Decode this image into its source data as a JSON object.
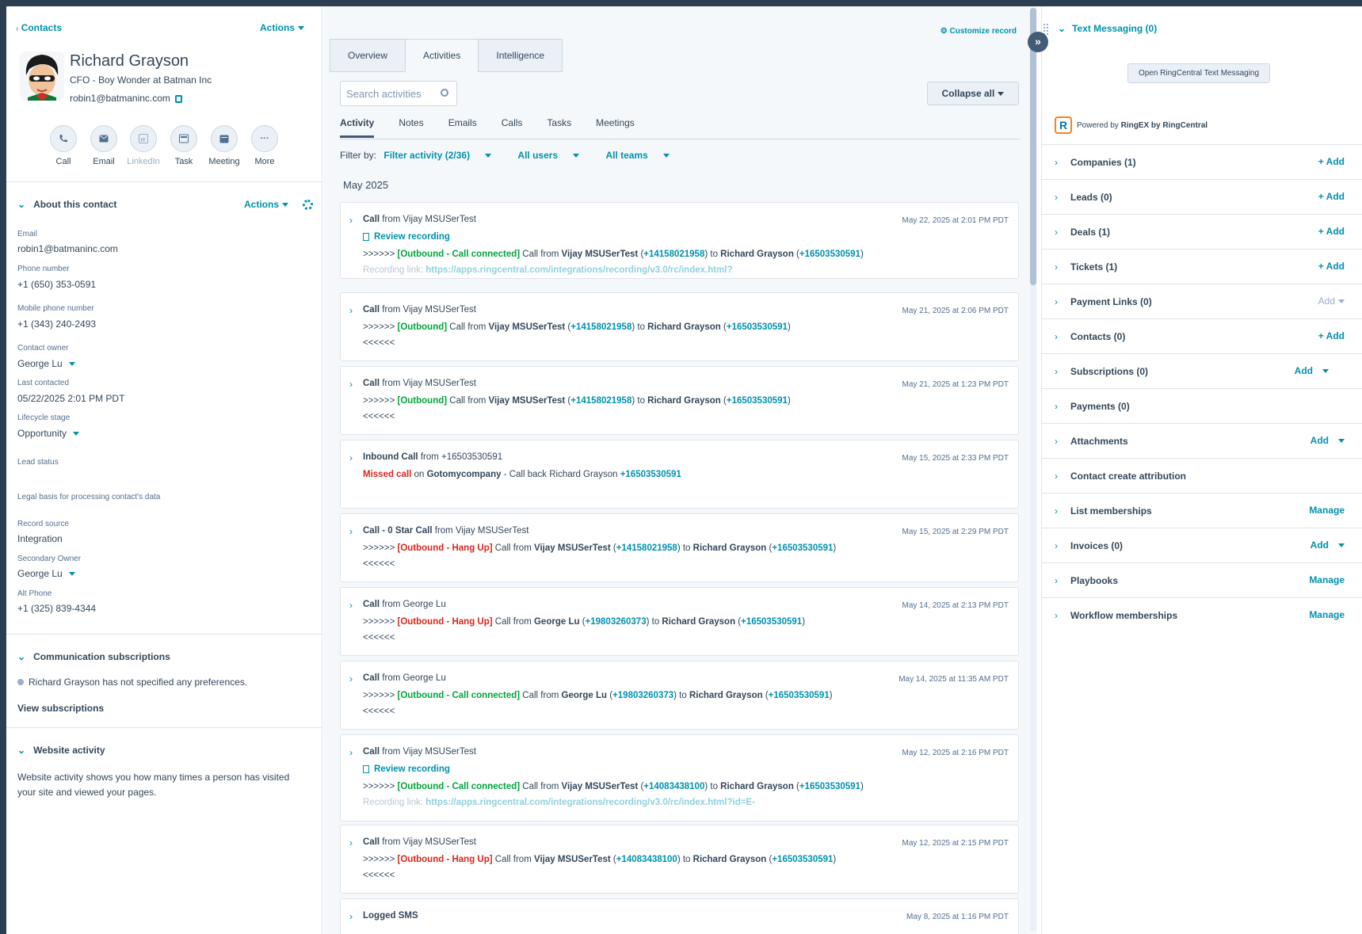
{
  "header": {
    "breadcrumb": "Contacts",
    "actions_label": "Actions"
  },
  "contact": {
    "name": "Richard Grayson",
    "subtitle": "CFO - Boy Wonder at Batman Inc",
    "email": "robin1@batmaninc.com"
  },
  "quick_actions": [
    {
      "label": "Call",
      "icon": "phone-icon"
    },
    {
      "label": "Email",
      "icon": "email-icon"
    },
    {
      "label": "LinkedIn",
      "icon": "linkedin-icon"
    },
    {
      "label": "Task",
      "icon": "task-icon"
    },
    {
      "label": "Meeting",
      "icon": "meeting-icon"
    },
    {
      "label": "More",
      "icon": "more-icon"
    }
  ],
  "about": {
    "title": "About this contact",
    "actions_label": "Actions",
    "fields": [
      {
        "label": "Email",
        "value": "robin1@batmaninc.com"
      },
      {
        "label": "Phone number",
        "value": "+1 (650) 353-0591"
      },
      {
        "label": "Mobile phone number",
        "value": "+1 (343) 240-2493"
      },
      {
        "label": "Contact owner",
        "value": "George Lu"
      },
      {
        "label": "Last contacted",
        "value": "05/22/2025 2:01 PM PDT"
      },
      {
        "label": "Lifecycle stage",
        "value": "Opportunity"
      },
      {
        "label": "Lead status",
        "value": ""
      },
      {
        "label": "Legal basis for processing contact's data",
        "value": ""
      },
      {
        "label": "Record source",
        "value": "Integration"
      },
      {
        "label": "Secondary Owner",
        "value": "George Lu"
      },
      {
        "label": "Alt Phone",
        "value": "+1 (325) 839-4344"
      }
    ]
  },
  "comm_subs": {
    "title": "Communication subscriptions",
    "text": "Richard Grayson has not specified any preferences.",
    "link": "View subscriptions"
  },
  "website": {
    "title": "Website activity",
    "text": "Website activity shows you how many times a person has visited your site and viewed your pages."
  },
  "middle": {
    "customize": "Customize record",
    "tabs": [
      "Overview",
      "Activities",
      "Intelligence"
    ],
    "search_placeholder": "Search activities",
    "collapse_all": "Collapse all",
    "subtabs": [
      "Activity",
      "Notes",
      "Emails",
      "Calls",
      "Tasks",
      "Meetings"
    ],
    "filter_by": "Filter by:",
    "filter_activity": "Filter activity (2/36)",
    "all_users": "All users",
    "all_teams": "All teams",
    "month": "May 2025"
  },
  "activities": [
    {
      "type": "Call",
      "from_label": "from Vijay MSUSerTest",
      "date": "May 22, 2025 at 2:01 PM PDT",
      "review": "Review recording",
      "prefix": ">>>>>> ",
      "status": "[Outbound - Call connected]",
      "status_color": "green",
      "mid": " Call from ",
      "caller": "Vijay MSUSerTest",
      "caller_num": "+14158021958",
      "to": "Richard Grayson",
      "to_num": "+16503530591",
      "rec_label": "Recording link: ",
      "rec_link": "https://apps.ringcentral.com/integrations/recording/v3.0/rc/index.html?"
    },
    {
      "type": "Call",
      "from_label": "from Vijay MSUSerTest",
      "date": "May 21, 2025 at 2:06 PM PDT",
      "prefix": ">>>>>> ",
      "status": "[Outbound]",
      "status_color": "green",
      "mid": " Call from ",
      "caller": "Vijay MSUSerTest",
      "caller_num": "+14158021958",
      "to": "Richard Grayson",
      "to_num": "+16503530591",
      "end": "<<<<<<"
    },
    {
      "type": "Call",
      "from_label": "from Vijay MSUSerTest",
      "date": "May 21, 2025 at 1:23 PM PDT",
      "prefix": ">>>>>> ",
      "status": "[Outbound]",
      "status_color": "green",
      "mid": " Call from ",
      "caller": "Vijay MSUSerTest",
      "caller_num": "+14158021958",
      "to": "Richard Grayson",
      "to_num": "+16503530591",
      "end": "<<<<<<"
    },
    {
      "type": "Inbound Call",
      "from_label": "from +16503530591",
      "date": "May 15, 2025 at 2:33 PM PDT",
      "missed": "Missed call",
      "on": " on ",
      "company": "Gotomycompany",
      "callback": " - Call back Richard Grayson ",
      "callback_num": "+16503530591"
    },
    {
      "type": "Call - 0 Star Call",
      "from_label": "from Vijay MSUSerTest",
      "date": "May 15, 2025 at 2:29 PM PDT",
      "prefix": ">>>>>> ",
      "status": "[Outbound - Hang Up]",
      "status_color": "red",
      "mid": " Call from ",
      "caller": "Vijay MSUSerTest",
      "caller_num": "+14158021958",
      "to": "Richard Grayson",
      "to_num": "+16503530591",
      "end": "<<<<<<"
    },
    {
      "type": "Call",
      "from_label": "from George Lu",
      "date": "May 14, 2025 at 2:13 PM PDT",
      "prefix": ">>>>>> ",
      "status": "[Outbound - Hang Up]",
      "status_color": "red",
      "mid": " Call from ",
      "caller": "George Lu",
      "caller_num": "+19803260373",
      "to": "Richard Grayson",
      "to_num": "+16503530591",
      "end": "<<<<<<"
    },
    {
      "type": "Call",
      "from_label": "from George Lu",
      "date": "May 14, 2025 at 11:35 AM PDT",
      "prefix": ">>>>>> ",
      "status": "[Outbound - Call connected]",
      "status_color": "green",
      "mid": " Call from ",
      "caller": "George Lu",
      "caller_num": "+19803260373",
      "to": "Richard Grayson",
      "to_num": "+16503530591",
      "end": "<<<<<<"
    },
    {
      "type": "Call",
      "from_label": "from Vijay MSUSerTest",
      "date": "May 12, 2025 at 2:16 PM PDT",
      "review": "Review recording",
      "prefix": ">>>>>> ",
      "status": "[Outbound - Call connected]",
      "status_color": "green",
      "mid": " Call from ",
      "caller": "Vijay MSUSerTest",
      "caller_num": "+14083438100",
      "to": "Richard Grayson",
      "to_num": "+16503530591",
      "rec_label": "Recording link: ",
      "rec_link": "https://apps.ringcentral.com/integrations/recording/v3.0/rc/index.html?id=E-"
    },
    {
      "type": "Call",
      "from_label": "from Vijay MSUSerTest",
      "date": "May 12, 2025 at 2:15 PM PDT",
      "prefix": ">>>>>> ",
      "status": "[Outbound - Hang Up]",
      "status_color": "red",
      "mid": " Call from ",
      "caller": "Vijay MSUSerTest",
      "caller_num": "+14083438100",
      "to": "Richard Grayson",
      "to_num": "+16503530591",
      "end": "<<<<<<"
    },
    {
      "type": "Logged SMS",
      "from_label": "",
      "date": "May 8, 2025 at 1:16 PM PDT"
    }
  ],
  "right": {
    "text_messaging": "Text Messaging (0)",
    "open_btn": "Open RingCentral Text Messaging",
    "powered_prefix": "Powered by ",
    "powered_brand": "RingEX by RingCentral",
    "logo_letter": "R",
    "cards": [
      {
        "label": "Companies (1)",
        "action": "+ Add"
      },
      {
        "label": "Leads (0)",
        "action": "+ Add"
      },
      {
        "label": "Deals (1)",
        "action": "+ Add"
      },
      {
        "label": "Tickets (1)",
        "action": "+ Add"
      },
      {
        "label": "Payment Links (0)",
        "action": "Add",
        "dropdown": true,
        "disabled": true
      },
      {
        "label": "Contacts (0)",
        "action": "+ Add"
      },
      {
        "label": "Subscriptions (0)",
        "action": "Add",
        "dropdown": true
      },
      {
        "label": "Payments (0)",
        "action": ""
      },
      {
        "label": "Attachments",
        "action": "Add",
        "dropdown": true
      },
      {
        "label": "Contact create attribution",
        "action": ""
      },
      {
        "label": "List memberships",
        "action": "Manage"
      },
      {
        "label": "Invoices (0)",
        "action": "Add",
        "dropdown": true
      },
      {
        "label": "Playbooks",
        "action": "Manage"
      },
      {
        "label": "Workflow memberships",
        "action": "Manage"
      }
    ]
  },
  "colors": {
    "accent": "#0091ae",
    "text": "#33475b",
    "green": "#00a53d",
    "red": "#d6271d"
  }
}
